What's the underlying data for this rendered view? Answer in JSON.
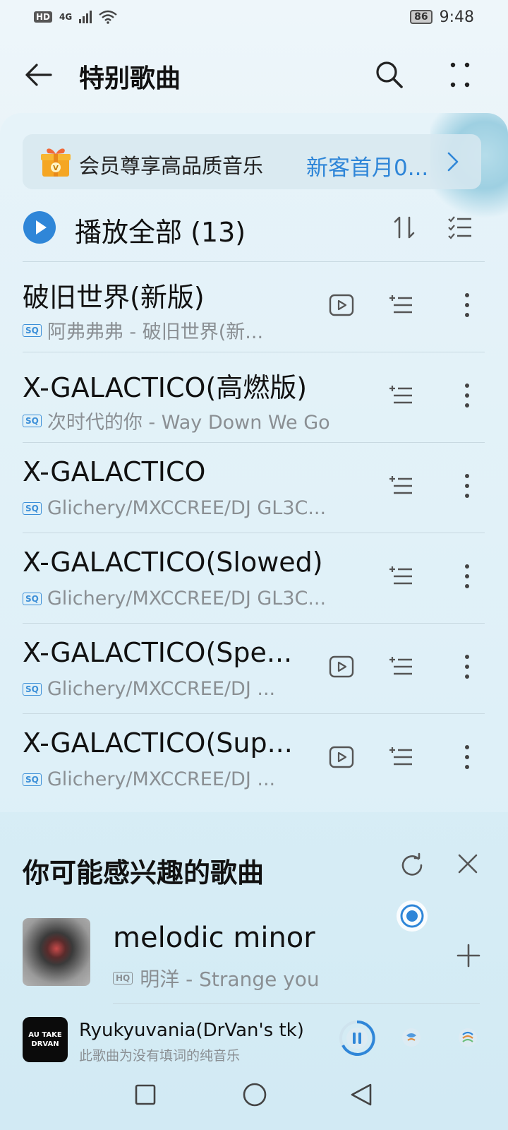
{
  "status_bar": {
    "hd": "HD",
    "network": "4G",
    "battery": "86",
    "time": "9:48"
  },
  "header": {
    "title": "特别歌曲"
  },
  "vip_banner": {
    "text": "会员尊享高品质音乐",
    "promo": "新客首月0..."
  },
  "playlist": {
    "play_all_label": "播放全部 (13)"
  },
  "songs": [
    {
      "title": "破旧世界(新版)",
      "quality": "SQ",
      "subtitle": "阿弗弗弗 - 破旧世界(新...",
      "has_mv": true
    },
    {
      "title": "X-GALACTICO(高燃版)",
      "quality": "SQ",
      "subtitle": "次时代的你 - Way Down We Go",
      "has_mv": false
    },
    {
      "title": "X-GALACTICO",
      "quality": "SQ",
      "subtitle": "Glichery/MXCCREE/DJ GL3C...",
      "has_mv": false
    },
    {
      "title": "X-GALACTICO(Slowed)",
      "quality": "SQ",
      "subtitle": "Glichery/MXCCREE/DJ GL3C...",
      "has_mv": false
    },
    {
      "title": "X-GALACTICO(Spe...",
      "quality": "SQ",
      "subtitle": "Glichery/MXCCREE/DJ ...",
      "has_mv": true
    },
    {
      "title": "X-GALACTICO(Sup...",
      "quality": "SQ",
      "subtitle": "Glichery/MXCCREE/DJ ...",
      "has_mv": true
    }
  ],
  "recommendations": {
    "title": "你可能感兴趣的歌曲",
    "item": {
      "title": "melodic minor",
      "quality": "HQ",
      "subtitle": "明洋 - Strange you"
    }
  },
  "mini_player": {
    "cover_line1": "AU TAKE",
    "cover_line2": "DRVAN",
    "title": "Ryukyuvania(DrVan's tk)",
    "subtitle": "此歌曲为没有填词的纯音乐"
  },
  "colors": {
    "accent": "#2f86d8",
    "background": "#e3f1f7"
  }
}
